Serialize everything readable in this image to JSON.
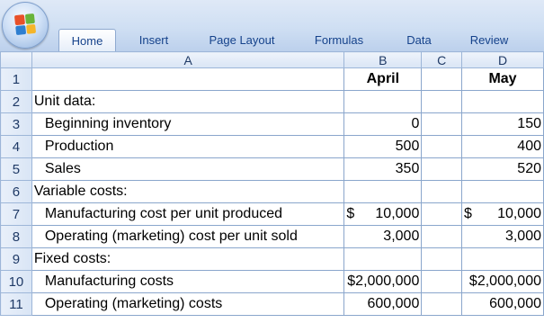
{
  "ribbon": {
    "tabs": [
      {
        "label": "Home",
        "active": true
      },
      {
        "label": "Insert"
      },
      {
        "label": "Page Layout"
      },
      {
        "label": "Formulas"
      },
      {
        "label": "Data"
      },
      {
        "label": "Review"
      }
    ]
  },
  "columns": {
    "a": "A",
    "b": "B",
    "c": "C",
    "d": "D"
  },
  "rows": [
    {
      "n": "1",
      "a": "",
      "b": "April",
      "c": "",
      "d": "May"
    },
    {
      "n": "2",
      "a": "Unit data:",
      "b": "",
      "c": "",
      "d": ""
    },
    {
      "n": "3",
      "a": "Beginning inventory",
      "b": "0",
      "c": "",
      "d": "150"
    },
    {
      "n": "4",
      "a": "Production",
      "b": "500",
      "c": "",
      "d": "400"
    },
    {
      "n": "5",
      "a": "Sales",
      "b": "350",
      "c": "",
      "d": "520"
    },
    {
      "n": "6",
      "a": "Variable costs:",
      "b": "",
      "c": "",
      "d": ""
    },
    {
      "n": "7",
      "a": "Manufacturing cost per unit produced",
      "b_sym": "$",
      "b": "10,000",
      "c": "",
      "d_sym": "$",
      "d": "10,000"
    },
    {
      "n": "8",
      "a": "Operating (marketing) cost per unit sold",
      "b": "3,000",
      "c": "",
      "d": "3,000"
    },
    {
      "n": "9",
      "a": "Fixed costs:",
      "b": "",
      "c": "",
      "d": ""
    },
    {
      "n": "10",
      "a": "Manufacturing costs",
      "b": "$2,000,000",
      "c": "",
      "d": "$2,000,000"
    },
    {
      "n": "11",
      "a": "Operating (marketing) costs",
      "b": "600,000",
      "c": "",
      "d": "600,000"
    }
  ]
}
